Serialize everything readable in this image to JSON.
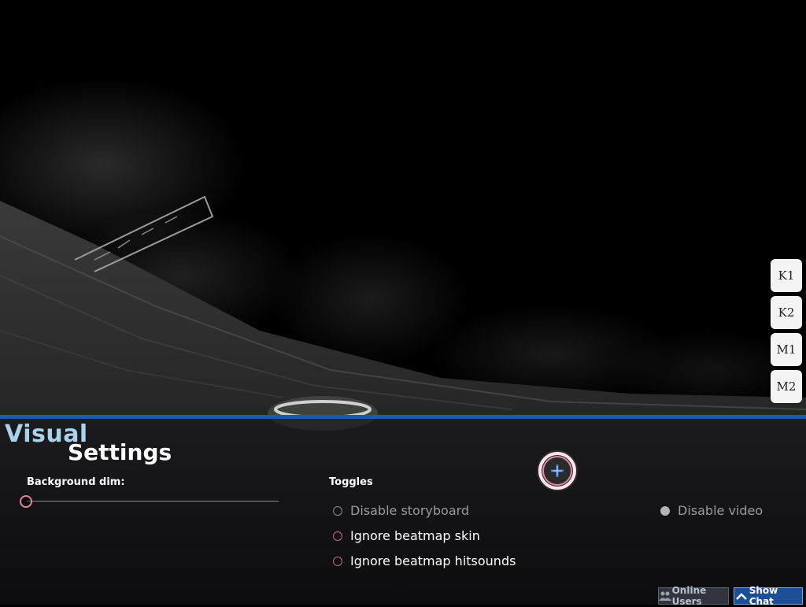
{
  "panel": {
    "title_line1": "Visual",
    "title_line2": "Settings",
    "background_dim": {
      "label": "Background dim:",
      "value": 0
    },
    "toggles_heading": "Toggles",
    "toggles": [
      {
        "label": "Disable storyboard",
        "checked": false,
        "enabled": false
      },
      {
        "label": "Ignore beatmap skin",
        "checked": false,
        "enabled": true
      },
      {
        "label": "Ignore beatmap hitsounds",
        "checked": false,
        "enabled": true
      },
      {
        "label": "Disable video",
        "checked": true,
        "enabled": false
      }
    ]
  },
  "keys": [
    {
      "label": "K1"
    },
    {
      "label": "K2"
    },
    {
      "label": "M1"
    },
    {
      "label": "M2"
    }
  ],
  "bottom_bar": {
    "online_users": "Online Users",
    "show_chat": "Show Chat"
  },
  "colors": {
    "accent_blue": "#1e5aa8",
    "title_blue": "#a9d3ea",
    "toggle_pink": "#c56a82"
  },
  "icons": [
    "cursor-icon",
    "users-icon",
    "chevron-up-icon"
  ]
}
